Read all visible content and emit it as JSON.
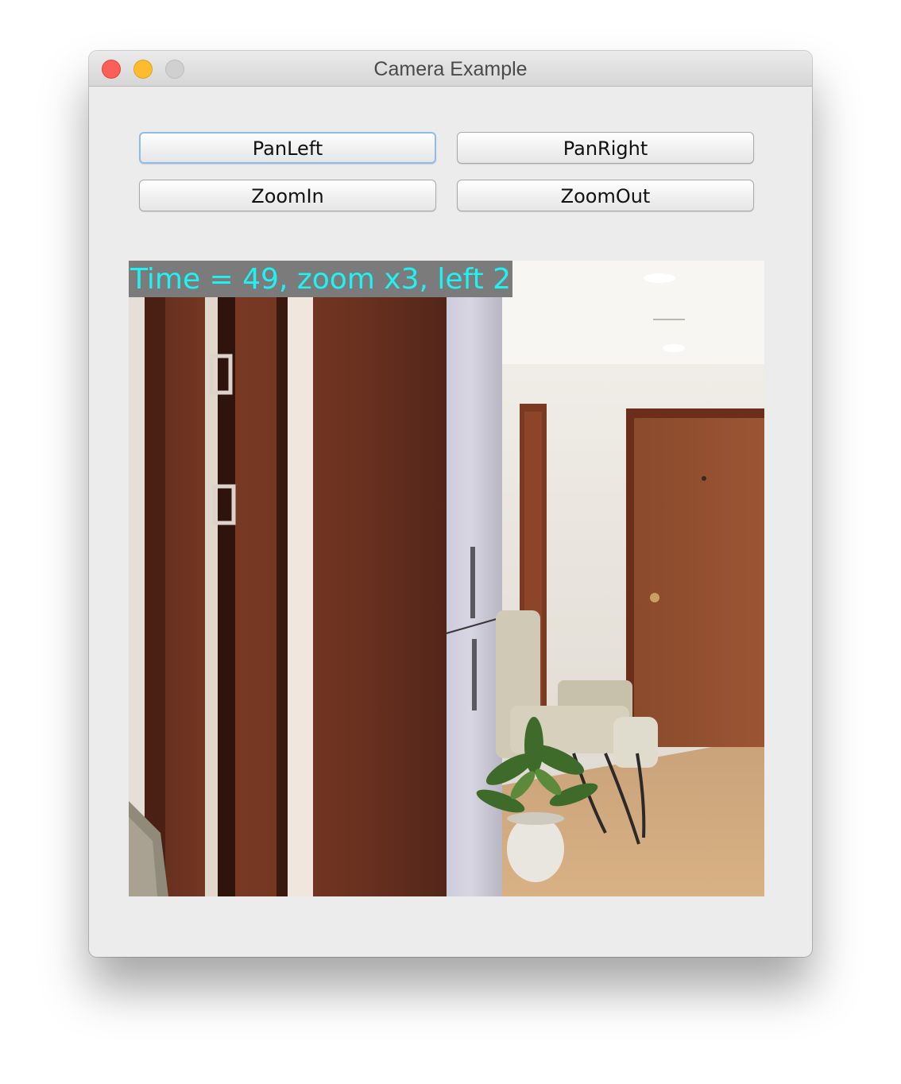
{
  "window": {
    "title": "Camera Example"
  },
  "controls": {
    "pan_left_label": "PanLeft",
    "pan_right_label": "PanRight",
    "zoom_in_label": "ZoomIn",
    "zoom_out_label": "ZoomOut"
  },
  "camera_view": {
    "overlay_text": "Time = 49, zoom x3, left 2"
  },
  "colors": {
    "close": "#fc5f57",
    "minimize": "#fdbc2e",
    "zoom": "#d0d0d0",
    "overlay_text": "#1ef2f2",
    "overlay_background": "#7b7b7b",
    "focus_ring": "#8fbcec"
  }
}
